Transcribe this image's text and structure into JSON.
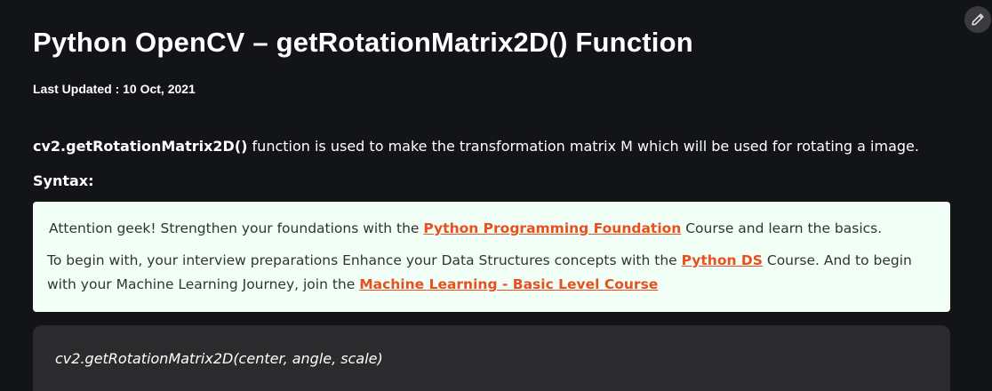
{
  "article": {
    "title": "Python OpenCV – getRotationMatrix2D() Function",
    "last_updated": "Last Updated : 10 Oct, 2021",
    "edit_icon": "pencil-icon",
    "intro": {
      "function_name": "cv2.getRotationMatrix2D()",
      "description": " function is used to make the transformation matrix M which will be used for rotating a image."
    },
    "syntax_label": "Syntax:"
  },
  "promo": {
    "line1_prefix": "Attention geek! Strengthen your foundations with the ",
    "line1_link": "Python Programming Foundation",
    "line1_suffix": " Course and learn the basics.",
    "line2_prefix": "To begin with, your interview preparations Enhance your Data Structures concepts with the ",
    "line2_link1": "Python DS",
    "line2_middle": " Course. And to begin with your Machine Learning Journey, join the ",
    "line2_link2": "Machine Learning - Basic Level Course",
    "link_color": "#e8501f",
    "background": "#f2fff7"
  },
  "code": {
    "signature": "cv2.getRotationMatrix2D(center, angle, scale)"
  }
}
